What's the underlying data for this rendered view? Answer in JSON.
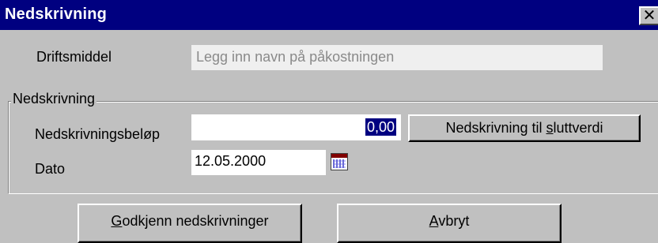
{
  "window": {
    "title": "Nedskrivning",
    "close_glyph": "✕"
  },
  "driftsmiddel": {
    "label": "Driftsmiddel",
    "value": "Legg inn navn på påkostningen"
  },
  "group": {
    "caption": "Nedskrivning",
    "amount_label": "Nedskrivningsbeløp",
    "amount_value": "0,00",
    "button_sluttverdi_pre": "Nedskrivning til ",
    "button_sluttverdi_u": "s",
    "button_sluttverdi_post": "luttverdi",
    "date_label": "Dato",
    "date_value": "12.05.2000",
    "date_icon": "calendar-icon"
  },
  "footer": {
    "approve_u": "G",
    "approve_rest": "odkjenn nedskrivninger",
    "cancel_u": "A",
    "cancel_rest": "vbryt"
  }
}
